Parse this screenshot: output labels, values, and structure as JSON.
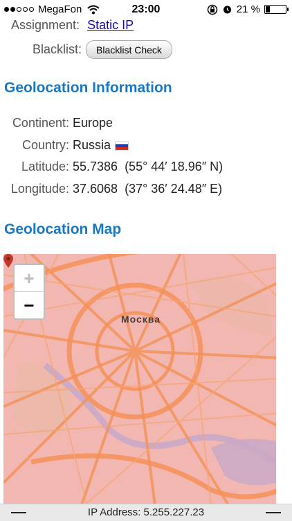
{
  "status_bar": {
    "carrier": "MegaFon",
    "time": "23:00",
    "battery": "21 %",
    "battery_level": 0.21
  },
  "assignment": {
    "label": "Assignment:",
    "value": "Static IP"
  },
  "blacklist": {
    "label": "Blacklist:",
    "button": "Blacklist Check"
  },
  "geolocation": {
    "title": "Geolocation Information",
    "rows": [
      {
        "label": "Continent:",
        "value": "Europe"
      },
      {
        "label": "Country:",
        "value": "Russia"
      },
      {
        "label": "Latitude:",
        "value": "55.7386  (55° 44′ 18.96″ N)"
      },
      {
        "label": "Longitude:",
        "value": "37.6068  (37° 36′ 24.48″ E)"
      }
    ]
  },
  "map": {
    "title": "Geolocation Map",
    "city_label": "Москва",
    "zoom_in": "+",
    "zoom_out": "−"
  },
  "bottom_bar": {
    "ip_text": "IP Address: 5.255.227.23"
  },
  "colors": {
    "heading": "#1a78c2",
    "link": "#1a0dab",
    "map_tint": "#f3b4b0",
    "roads": "#f08c52"
  }
}
